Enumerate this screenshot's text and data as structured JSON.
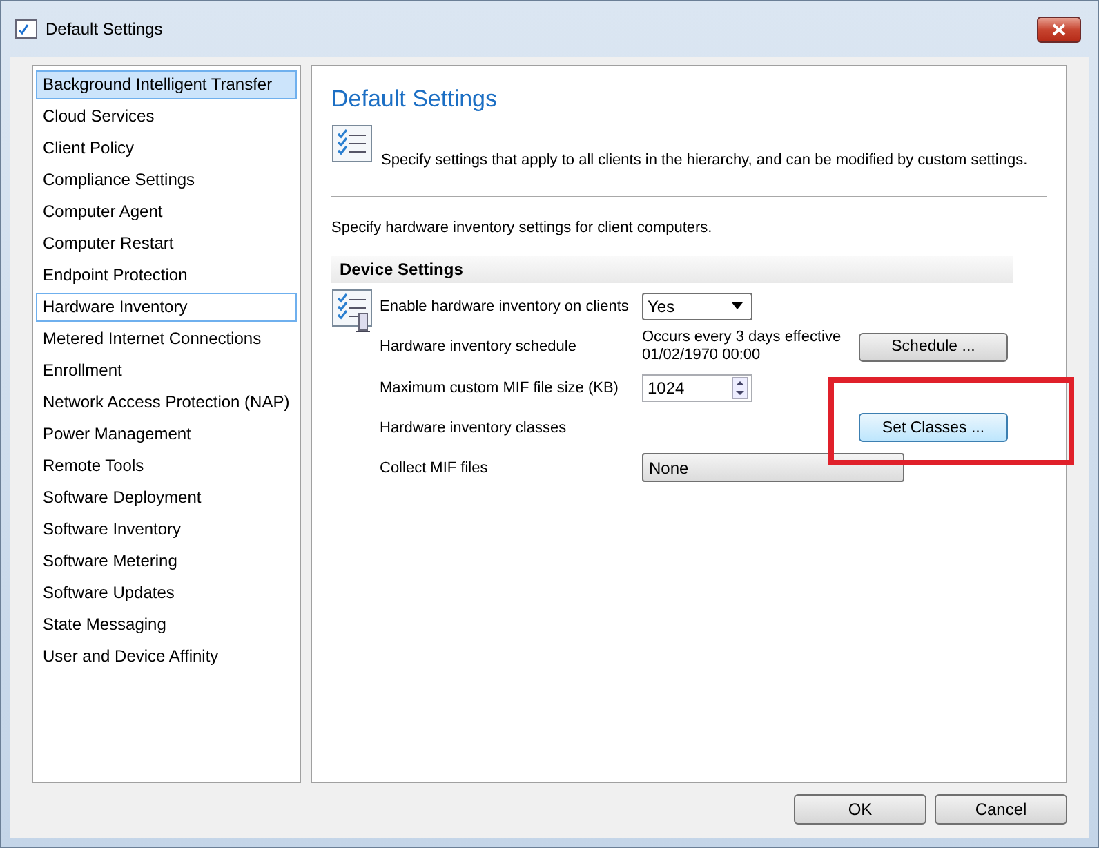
{
  "window": {
    "title": "Default Settings"
  },
  "sidebar": {
    "items": [
      {
        "label": "Background Intelligent Transfer",
        "selected": true,
        "focused": false
      },
      {
        "label": "Cloud Services",
        "selected": false,
        "focused": false
      },
      {
        "label": "Client Policy",
        "selected": false,
        "focused": false
      },
      {
        "label": "Compliance Settings",
        "selected": false,
        "focused": false
      },
      {
        "label": "Computer Agent",
        "selected": false,
        "focused": false
      },
      {
        "label": "Computer Restart",
        "selected": false,
        "focused": false
      },
      {
        "label": "Endpoint Protection",
        "selected": false,
        "focused": false
      },
      {
        "label": "Hardware Inventory",
        "selected": false,
        "focused": true
      },
      {
        "label": "Metered Internet Connections",
        "selected": false,
        "focused": false
      },
      {
        "label": "Enrollment",
        "selected": false,
        "focused": false
      },
      {
        "label": "Network Access Protection (NAP)",
        "selected": false,
        "focused": false
      },
      {
        "label": "Power Management",
        "selected": false,
        "focused": false
      },
      {
        "label": "Remote Tools",
        "selected": false,
        "focused": false
      },
      {
        "label": "Software Deployment",
        "selected": false,
        "focused": false
      },
      {
        "label": "Software Inventory",
        "selected": false,
        "focused": false
      },
      {
        "label": "Software Metering",
        "selected": false,
        "focused": false
      },
      {
        "label": "Software Updates",
        "selected": false,
        "focused": false
      },
      {
        "label": "State Messaging",
        "selected": false,
        "focused": false
      },
      {
        "label": "User and Device Affinity",
        "selected": false,
        "focused": false
      }
    ]
  },
  "panel": {
    "title": "Default Settings",
    "description": "Specify settings that apply to all clients in the hierarchy, and can be modified by custom settings.",
    "intro": "Specify hardware inventory settings for client computers.",
    "section": "Device Settings",
    "rows": [
      {
        "kind": "dropdown",
        "label": "Enable hardware inventory on clients",
        "value": "Yes",
        "highlighted": false
      },
      {
        "kind": "button",
        "label": "Hardware inventory schedule",
        "info": "Occurs every 3 days effective 01/02/1970 00:00",
        "button": "Schedule ...",
        "highlighted": false
      },
      {
        "kind": "spinner",
        "label": "Maximum custom MIF file size (KB)",
        "value": "1024",
        "highlighted": false
      },
      {
        "kind": "button",
        "label": "Hardware inventory classes",
        "button": "Set Classes ...",
        "highlighted": true
      },
      {
        "kind": "combo",
        "label": "Collect MIF files",
        "value": "None",
        "highlighted": false
      }
    ]
  },
  "buttons": [
    "OK",
    "Cancel"
  ]
}
